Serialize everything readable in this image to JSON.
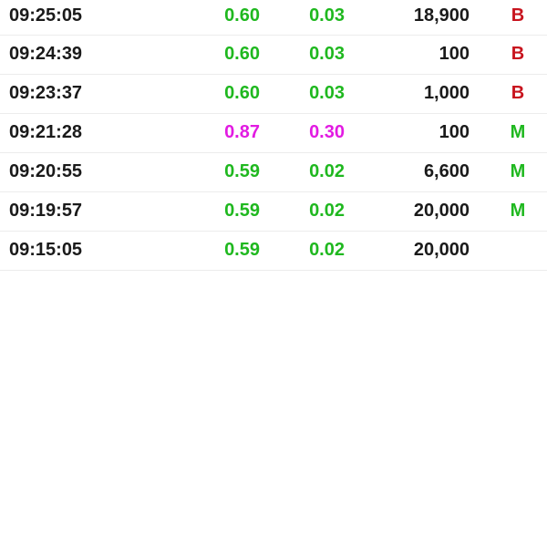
{
  "colors": {
    "up": "#1fb81f",
    "ceiling": "#e21be2",
    "buy": "#c8141e",
    "match": "#1fb81f",
    "text": "#1a1a1a"
  },
  "trades": [
    {
      "time": "09:25:05",
      "price": "0.60",
      "change": "0.03",
      "volume": "18,900",
      "side": "B",
      "price_color": "#1fb81f",
      "side_color": "#c8141e"
    },
    {
      "time": "09:24:39",
      "price": "0.60",
      "change": "0.03",
      "volume": "100",
      "side": "B",
      "price_color": "#1fb81f",
      "side_color": "#c8141e"
    },
    {
      "time": "09:23:37",
      "price": "0.60",
      "change": "0.03",
      "volume": "1,000",
      "side": "B",
      "price_color": "#1fb81f",
      "side_color": "#c8141e"
    },
    {
      "time": "09:21:28",
      "price": "0.87",
      "change": "0.30",
      "volume": "100",
      "side": "M",
      "price_color": "#e21be2",
      "side_color": "#1fb81f"
    },
    {
      "time": "09:20:55",
      "price": "0.59",
      "change": "0.02",
      "volume": "6,600",
      "side": "M",
      "price_color": "#1fb81f",
      "side_color": "#1fb81f"
    },
    {
      "time": "09:19:57",
      "price": "0.59",
      "change": "0.02",
      "volume": "20,000",
      "side": "M",
      "price_color": "#1fb81f",
      "side_color": "#1fb81f"
    },
    {
      "time": "09:15:05",
      "price": "0.59",
      "change": "0.02",
      "volume": "20,000",
      "side": "",
      "price_color": "#1fb81f",
      "side_color": "#1fb81f"
    }
  ]
}
